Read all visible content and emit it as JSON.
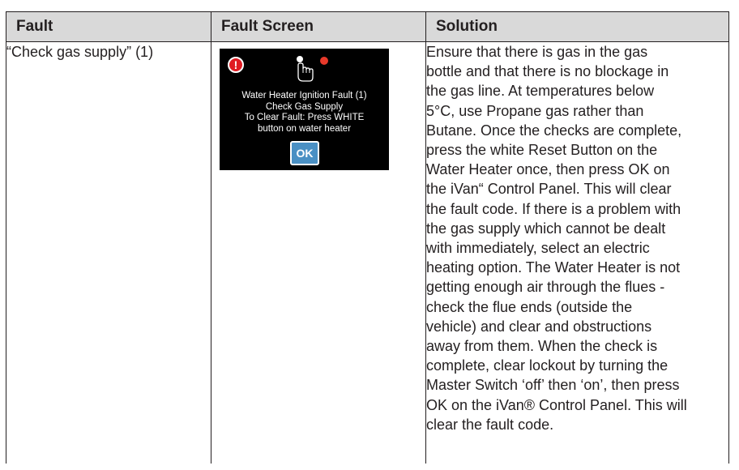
{
  "table": {
    "headers": [
      "Fault",
      "Fault Screen",
      "Solution"
    ],
    "row": {
      "fault": "“Check gas supply” (1)",
      "screen": {
        "alert_icon": "exclamation-circle-icon",
        "touch_icon": "pointing-hand-icon",
        "message_lines": [
          "Water Heater Ignition Fault (1)",
          "Check Gas Supply",
          "To Clear Fault: Press WHITE",
          "button on water heater"
        ],
        "ok_label": "OK",
        "colors": {
          "background": "#000000",
          "alert": "#e01b22",
          "ok_button": "#4a90c4"
        }
      },
      "solution_lines": [
        "Ensure that there is gas in the gas",
        "bottle and that there is no blockage in",
        "the gas line. At temperatures below",
        "5°C, use Propane gas rather than",
        "Butane. Once the checks are complete,",
        "press the white Reset Button on the",
        "Water Heater once, then press OK on",
        "the iVan“ Control Panel. This will clear",
        "the fault code. If there is a problem with",
        "the gas supply which cannot be dealt",
        "with immediately, select an electric",
        "heating option. The Water Heater is not",
        "getting enough air through the flues -",
        "check the flue ends (outside the",
        "vehicle) and clear and obstructions",
        "away from them. When the check is",
        "complete, clear lockout by turning the",
        "Master Switch ‘off’ then ‘on’, then press",
        "OK on the iVan® Control Panel. This will",
        "clear the fault code."
      ]
    }
  }
}
